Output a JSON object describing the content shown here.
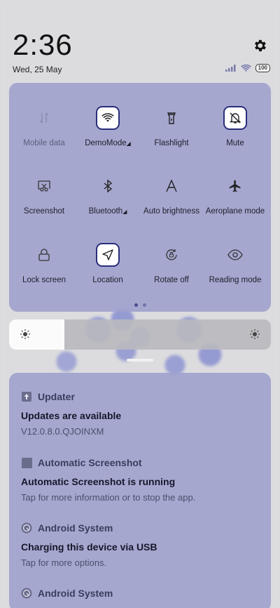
{
  "header": {
    "time": "2:36",
    "date": "Wed, 25 May",
    "battery": "100",
    "icons": [
      "signal-icon",
      "wifi-icon",
      "battery-icon",
      "gear-icon"
    ]
  },
  "quick_settings": {
    "tiles": [
      {
        "label": "Mobile data",
        "icon": "mobile-data-icon",
        "active": false,
        "dim": true
      },
      {
        "label": "DemoMode",
        "icon": "wifi-icon",
        "active": true,
        "dropdown": true
      },
      {
        "label": "Flashlight",
        "icon": "flashlight-icon",
        "active": false
      },
      {
        "label": "Mute",
        "icon": "bell-off-icon",
        "active": true
      },
      {
        "label": "Screenshot",
        "icon": "screenshot-icon",
        "active": false
      },
      {
        "label": "Bluetooth",
        "icon": "bluetooth-icon",
        "active": false,
        "dropdown": true
      },
      {
        "label": "Auto brightness",
        "icon": "auto-brightness-icon",
        "active": false
      },
      {
        "label": "Aeroplane mode",
        "icon": "airplane-icon",
        "active": false
      },
      {
        "label": "Lock screen",
        "icon": "lock-icon",
        "active": false
      },
      {
        "label": "Location",
        "icon": "location-arrow-icon",
        "active": true
      },
      {
        "label": "Rotate off",
        "icon": "rotate-lock-icon",
        "active": false
      },
      {
        "label": "Reading mode",
        "icon": "eye-icon",
        "active": false
      }
    ],
    "page_indicator": {
      "pages": 2,
      "current": 1
    }
  },
  "brightness": {
    "level": 0.21,
    "icon": "sun-icon"
  },
  "notifications": [
    {
      "app": "Updater",
      "app_icon": "updater-icon",
      "title": "Updates are available",
      "body": "V12.0.8.0.QJOINXM"
    },
    {
      "app": "Automatic Screenshot",
      "app_icon": "square-icon",
      "title": "Automatic Screenshot is running",
      "body": "Tap for more information or to stop the app."
    },
    {
      "app": "Android System",
      "app_icon": "android-system-icon",
      "title": "Charging this device via USB",
      "body": "Tap for more options."
    },
    {
      "app": "Android System",
      "app_icon": "android-system-icon",
      "title": "",
      "body": ""
    }
  ]
}
